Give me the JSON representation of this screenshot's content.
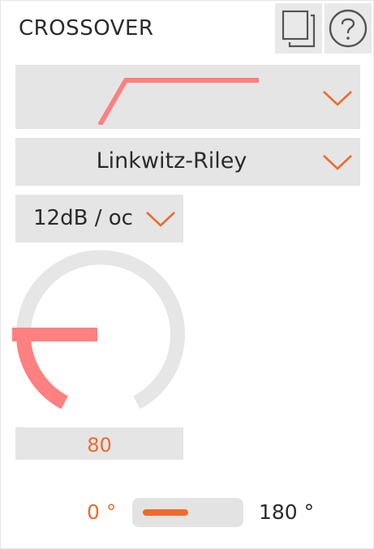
{
  "header": {
    "title": "CROSSOVER",
    "copy_icon": "copy-icon",
    "help_icon": "help-icon"
  },
  "filter_shape": {
    "icon": "highpass-curve-icon",
    "color": "#ff8080"
  },
  "filter_type": {
    "value": "Linkwitz-Riley"
  },
  "slope": {
    "value": "12dB / oc"
  },
  "frequency": {
    "value": "80",
    "knob_fraction": 0.18
  },
  "phase": {
    "min_label": "0 °",
    "max_label": "180 °",
    "state": "0"
  },
  "colors": {
    "accent": "#ee6b2c",
    "knob_active": "#ff8080",
    "control_bg": "#e5e5e5",
    "track": "#e6e6e6"
  }
}
